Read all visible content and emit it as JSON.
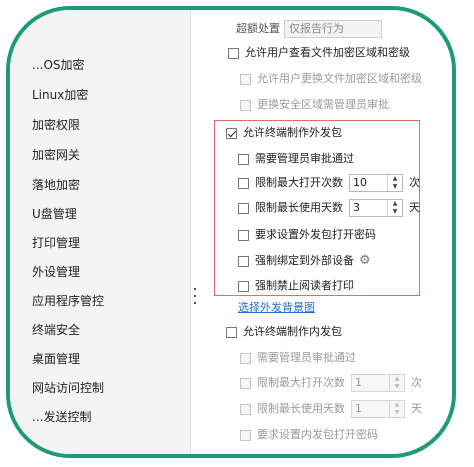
{
  "sidebar": {
    "items": [
      {
        "label": "...OS加密"
      },
      {
        "label": "Linux加密"
      },
      {
        "label": "加密权限"
      },
      {
        "label": "加密网关"
      },
      {
        "label": "落地加密"
      },
      {
        "label": "U盘管理"
      },
      {
        "label": "打印管理"
      },
      {
        "label": "外设管理"
      },
      {
        "label": "应用程序管控"
      },
      {
        "label": "终端安全"
      },
      {
        "label": "桌面管理"
      },
      {
        "label": "网站访问控制"
      },
      {
        "label": "...发送控制"
      }
    ]
  },
  "top": {
    "label": "超额处置",
    "value": "仅报告行为"
  },
  "options": {
    "allow_view_encrypted": "允许用户查看文件加密区域和密级",
    "allow_change_encrypted": "允许用户更换文件加密区域和密级",
    "change_security_requires_admin": "更换安全区域需管理员审批"
  },
  "external": {
    "title": "允许终端制作外发包",
    "require_admin": "需要管理员审批通过",
    "limit_open": "限制最大打开次数",
    "limit_open_value": "10",
    "limit_open_unit": "次",
    "limit_days": "限制最长使用天数",
    "limit_days_value": "3",
    "limit_days_unit": "天",
    "require_password": "要求设置外发包打开密码",
    "bind_device": "强制绑定到外部设备",
    "forbid_print": "强制禁止阅读者打印",
    "select_bg_link": "选择外发背景图"
  },
  "internal": {
    "title": "允许终端制作内发包",
    "require_admin": "需要管理员审批通过",
    "limit_open": "限制最大打开次数",
    "limit_open_value": "1",
    "limit_open_unit": "次",
    "limit_days": "限制最长使用天数",
    "limit_days_value": "1",
    "limit_days_unit": "天",
    "require_password": "要求设置内发包打开密码"
  },
  "colors": {
    "frame": "#1f9a78",
    "highlight": "#e56a6a",
    "link": "#1f6fd1"
  }
}
